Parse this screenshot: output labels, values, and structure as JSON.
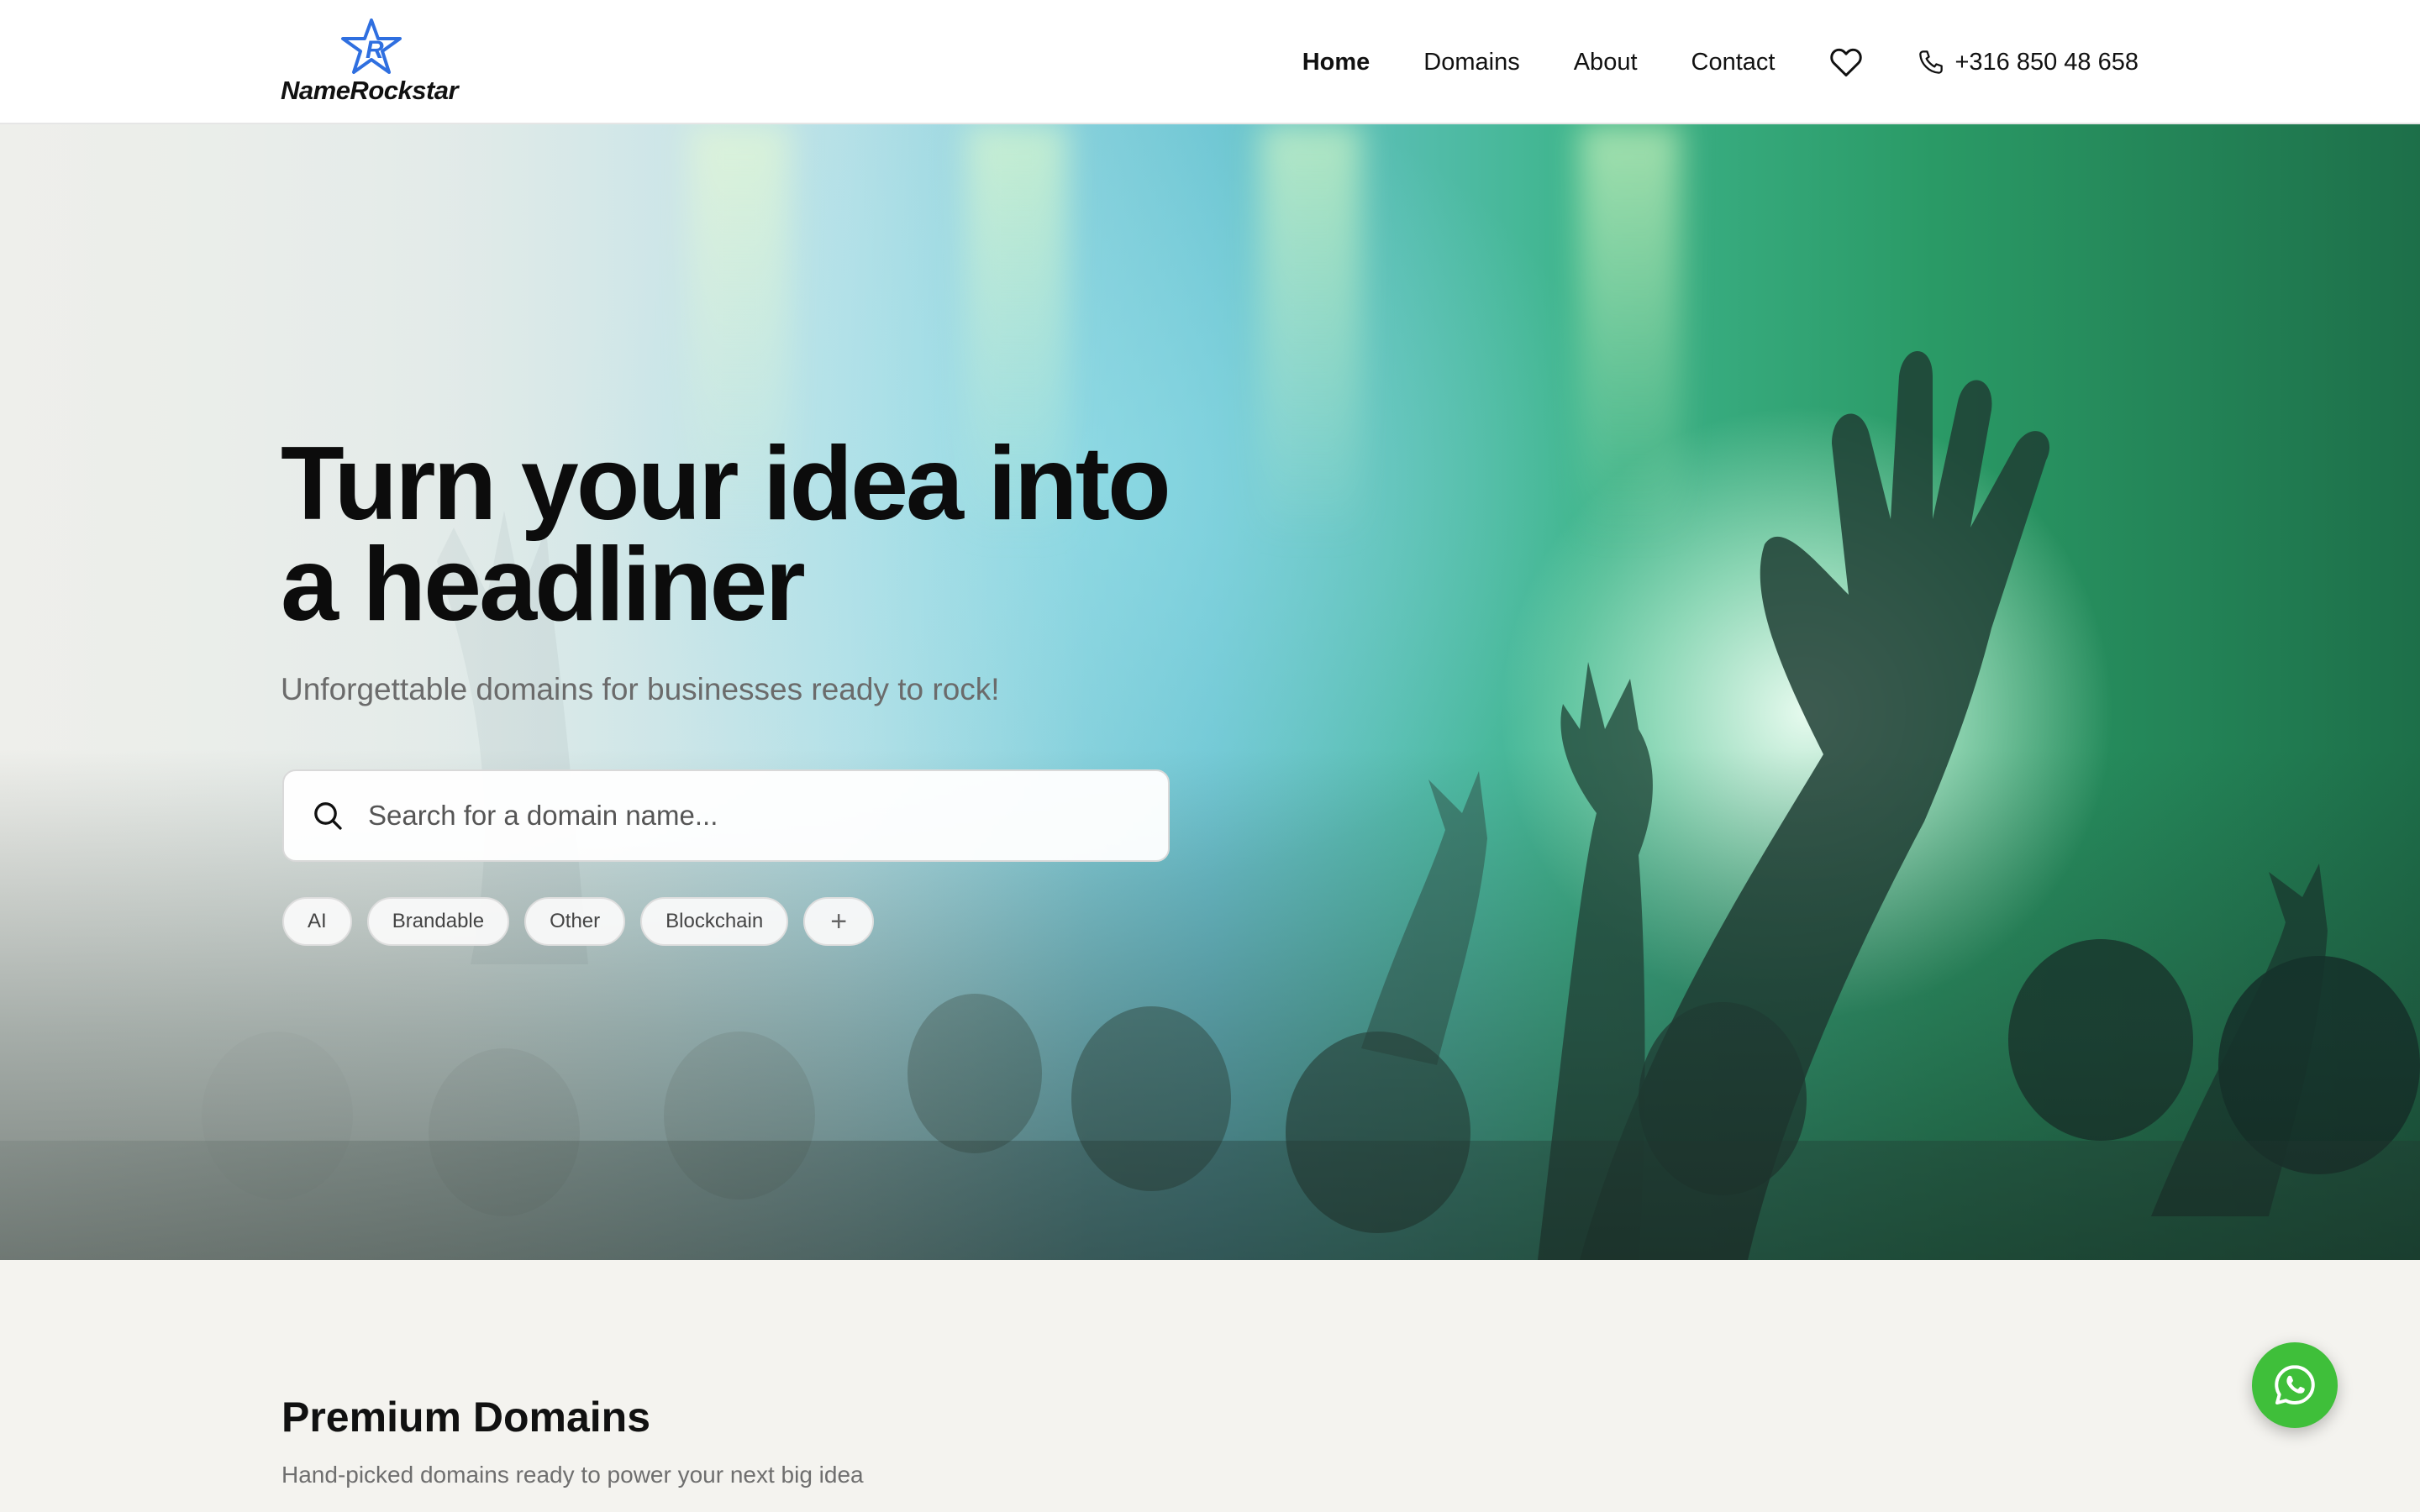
{
  "brand": {
    "name": "NameRockstar",
    "logo_icon": "star-r-logo-icon",
    "accent": "#2f6fe0"
  },
  "nav": {
    "links": [
      {
        "label": "Home",
        "active": true
      },
      {
        "label": "Domains",
        "active": false
      },
      {
        "label": "About",
        "active": false
      },
      {
        "label": "Contact",
        "active": false
      }
    ],
    "favorites_icon": "heart-icon",
    "phone_icon": "phone-icon",
    "phone": "+316 850 48 658"
  },
  "hero": {
    "title": "Turn your idea into a headliner",
    "subtitle": "Unforgettable domains for businesses ready to rock!",
    "search": {
      "placeholder": "Search for a domain name...",
      "value": "",
      "icon": "search-icon"
    },
    "chips": [
      "AI",
      "Brandable",
      "Other",
      "Blockchain",
      "+"
    ]
  },
  "premium": {
    "title": "Premium Domains",
    "subtitle": "Hand-picked domains ready to power your next big idea"
  },
  "whatsapp": {
    "icon": "whatsapp-icon",
    "color": "#3fbf3a"
  }
}
